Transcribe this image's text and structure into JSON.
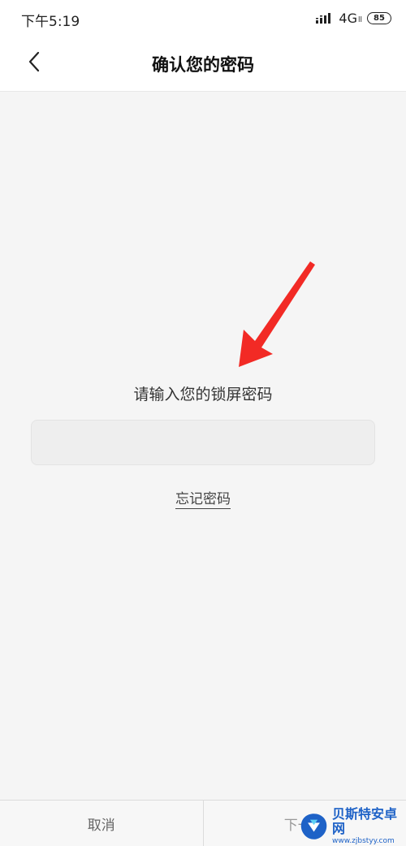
{
  "status_bar": {
    "time": "下午5:19",
    "network": "4G",
    "network_sub": "ll",
    "battery": "85",
    "icons": [
      "signal-icon",
      "battery-icon"
    ]
  },
  "header": {
    "title": "确认您的密码",
    "back_icon": "chevron-left-icon"
  },
  "main": {
    "prompt": "请输入您的锁屏密码",
    "password_value": "",
    "forgot_label": "忘记密码"
  },
  "footer": {
    "cancel_label": "取消",
    "next_label": "下一步"
  },
  "watermark": {
    "title": "贝斯特安卓网",
    "url": "www.zjbstyy.com"
  },
  "colors": {
    "arrow": "#f22a25",
    "background": "#f5f5f5",
    "watermark_blue": "#1e62c7"
  }
}
